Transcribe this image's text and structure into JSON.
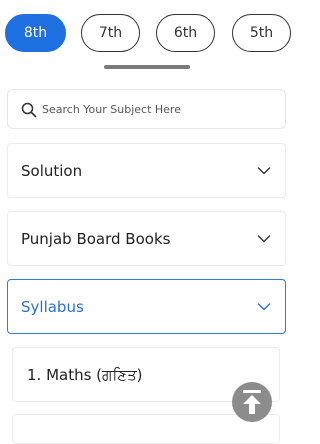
{
  "class_tabs": [
    {
      "label": "8th",
      "active": true
    },
    {
      "label": "7th",
      "active": false
    },
    {
      "label": "6th",
      "active": false
    },
    {
      "label": "5th",
      "active": false
    }
  ],
  "search": {
    "placeholder": "Search Your Subject Here",
    "value": ""
  },
  "sections": [
    {
      "title": "Solution",
      "expanded": false
    },
    {
      "title": "Punjab Board Books",
      "expanded": false
    },
    {
      "title": "Syllabus",
      "expanded": true
    }
  ],
  "syllabus_items": [
    {
      "label": "1. Maths (ਗਣਿਤ)"
    }
  ],
  "colors": {
    "accent": "#1e6fe0",
    "active_border": "#2f7ae5",
    "scroll_top_bg": "#8c8c8c"
  },
  "icons": {
    "search": "search-icon",
    "chevron": "chevron-down-icon",
    "scroll_top": "arrow-up-to-line-icon"
  }
}
